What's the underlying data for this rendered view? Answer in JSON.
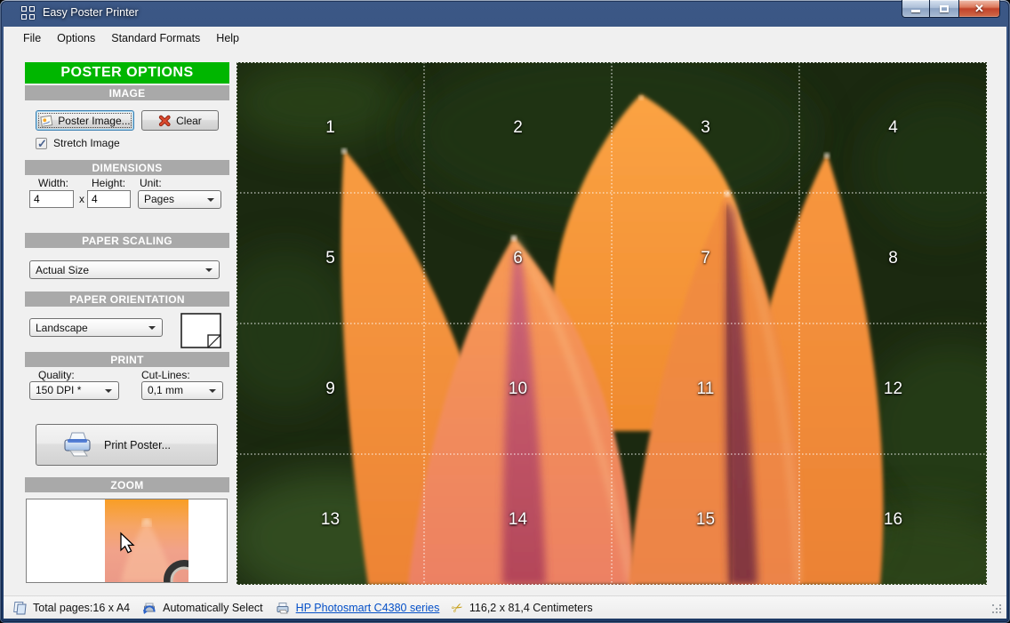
{
  "window": {
    "title": "Easy Poster Printer",
    "controls": {
      "minimize": "minimize",
      "maximize": "maximize",
      "close": "close"
    }
  },
  "menubar": {
    "items": [
      "File",
      "Options",
      "Standard Formats",
      "Help"
    ]
  },
  "sidebar": {
    "title": "POSTER OPTIONS",
    "accent_green": "#00B600",
    "section_header_gray": "#A9A9A9",
    "image": {
      "header": "IMAGE",
      "poster_image_button": "Poster Image...",
      "clear_button": "Clear",
      "stretch_checkbox_label": "Stretch Image",
      "stretch_checked": true
    },
    "dimensions": {
      "header": "DIMENSIONS",
      "width_label": "Width:",
      "height_label": "Height:",
      "unit_label": "Unit:",
      "width_value": "4",
      "times_separator": "x",
      "height_value": "4",
      "unit_value": "Pages"
    },
    "paper_scaling": {
      "header": "PAPER SCALING",
      "value": "Actual Size"
    },
    "paper_orientation": {
      "header": "PAPER ORIENTATION",
      "value": "Landscape"
    },
    "print": {
      "header": "PRINT",
      "quality_label": "Quality:",
      "quality_value": "150 DPI *",
      "cutlines_label": "Cut-Lines:",
      "cutlines_value": "0,1 mm",
      "print_button": "Print Poster..."
    },
    "zoom": {
      "header": "ZOOM"
    }
  },
  "poster": {
    "grid": {
      "rows": 4,
      "cols": 4
    },
    "cell_numbers": [
      "1",
      "2",
      "3",
      "4",
      "5",
      "6",
      "7",
      "8",
      "9",
      "10",
      "11",
      "12",
      "13",
      "14",
      "15",
      "16"
    ]
  },
  "statusbar": {
    "total_pages": "Total pages:16 x A4",
    "paper_source": "Automatically Select",
    "printer_link": "HP Photosmart C4380 series",
    "poster_size": "116,2 x 81,4 Centimeters"
  }
}
